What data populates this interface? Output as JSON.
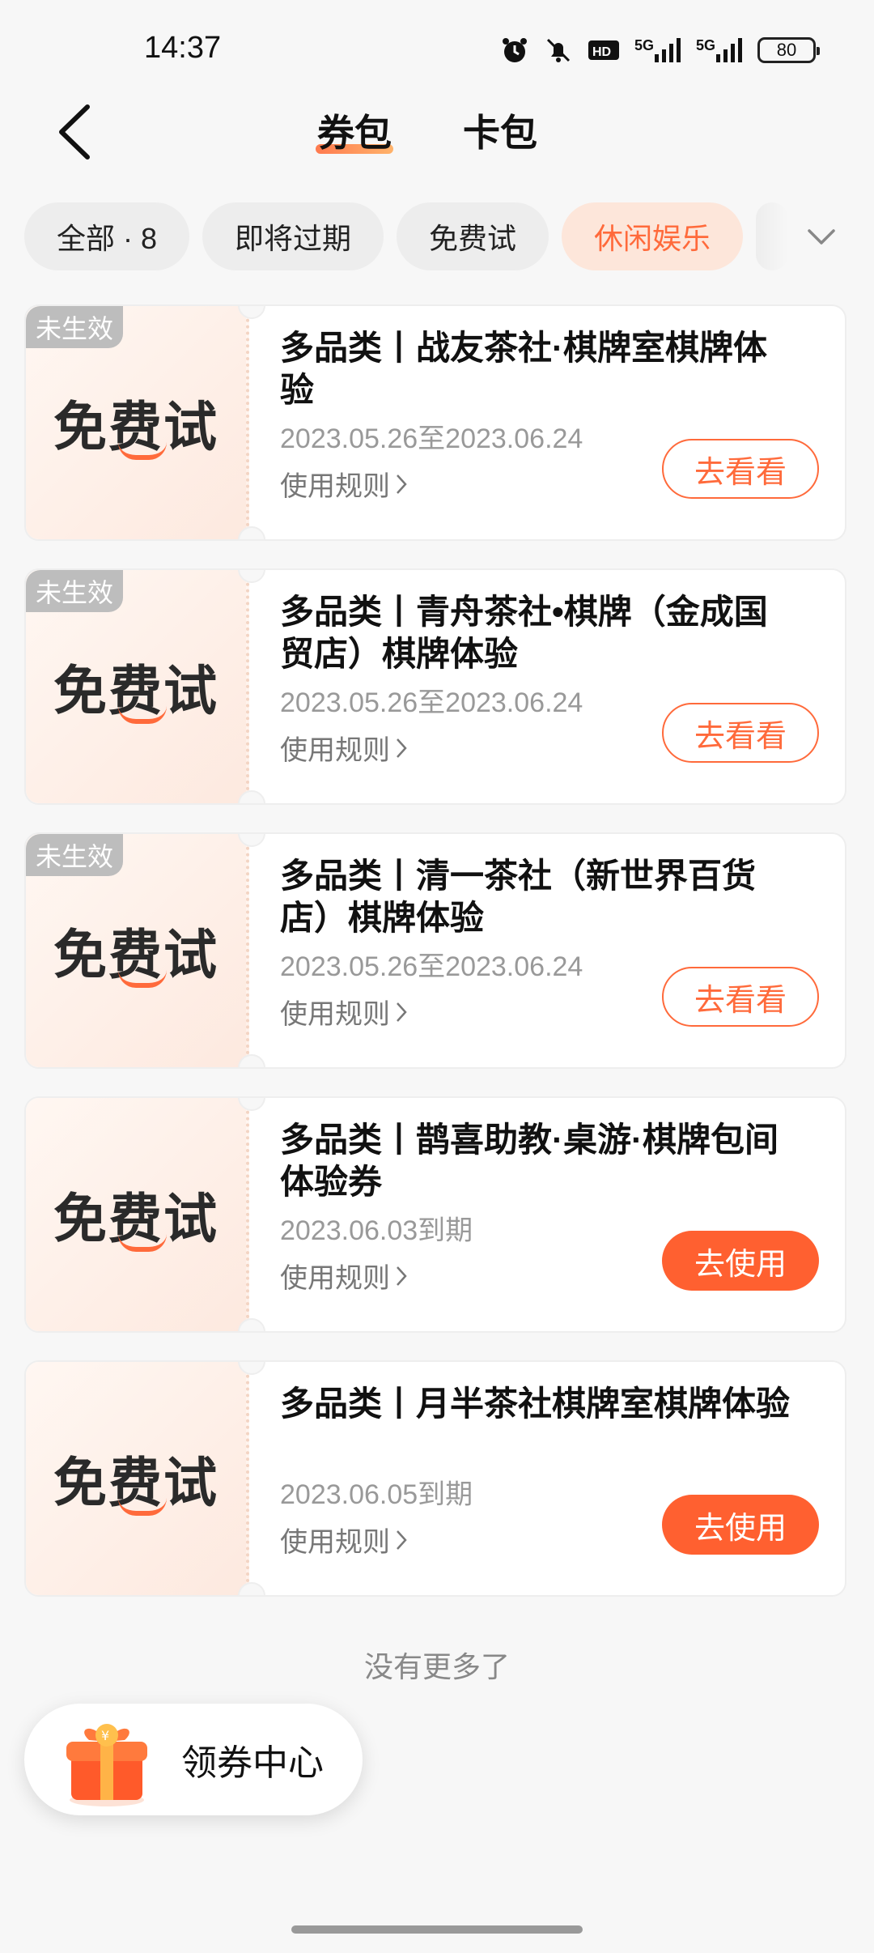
{
  "status_bar": {
    "time": "14:37",
    "net1_label": "5G",
    "net2_label": "5G",
    "battery": "80",
    "icons": [
      "alarm-icon",
      "mute-icon",
      "hd-icon",
      "signal-icon",
      "signal-icon",
      "battery-icon"
    ]
  },
  "nav": {
    "tabs": [
      {
        "label": "券包",
        "active": true
      },
      {
        "label": "卡包",
        "active": false
      }
    ]
  },
  "filters": {
    "chips": [
      {
        "label": "全部 · 8",
        "active": false
      },
      {
        "label": "即将过期",
        "active": false
      },
      {
        "label": "免费试",
        "active": false
      },
      {
        "label": "休闲娱乐",
        "active": true
      }
    ]
  },
  "coupons": [
    {
      "tag": "未生效",
      "logo": "免费试",
      "title": "多品类丨战友茶社·棋牌室棋牌体验",
      "date": "2023.05.26至2023.06.24",
      "rules": "使用规则",
      "action": "去看看",
      "action_style": "outline"
    },
    {
      "tag": "未生效",
      "logo": "免费试",
      "title": "多品类丨青舟茶社•棋牌（金成国贸店）棋牌体验",
      "date": "2023.05.26至2023.06.24",
      "rules": "使用规则",
      "action": "去看看",
      "action_style": "outline"
    },
    {
      "tag": "未生效",
      "logo": "免费试",
      "title": "多品类丨清一茶社（新世界百货店）棋牌体验",
      "date": "2023.05.26至2023.06.24",
      "rules": "使用规则",
      "action": "去看看",
      "action_style": "outline"
    },
    {
      "tag": "",
      "logo": "免费试",
      "title": "多品类丨鹊喜助教·桌游·棋牌包间体验券",
      "date": "2023.06.03到期",
      "rules": "使用规则",
      "action": "去使用",
      "action_style": "filled"
    },
    {
      "tag": "",
      "logo": "免费试",
      "title": "多品类丨月半茶社棋牌室棋牌体验",
      "date": "2023.06.05到期",
      "rules": "使用规则",
      "action": "去使用",
      "action_style": "filled"
    }
  ],
  "footer": {
    "no_more": "没有更多了",
    "coupon_center": "领券中心"
  },
  "colors": {
    "accent": "#ff6a3b",
    "accent_fill": "#ff6030",
    "tag_gray": "#bdbdbd"
  }
}
